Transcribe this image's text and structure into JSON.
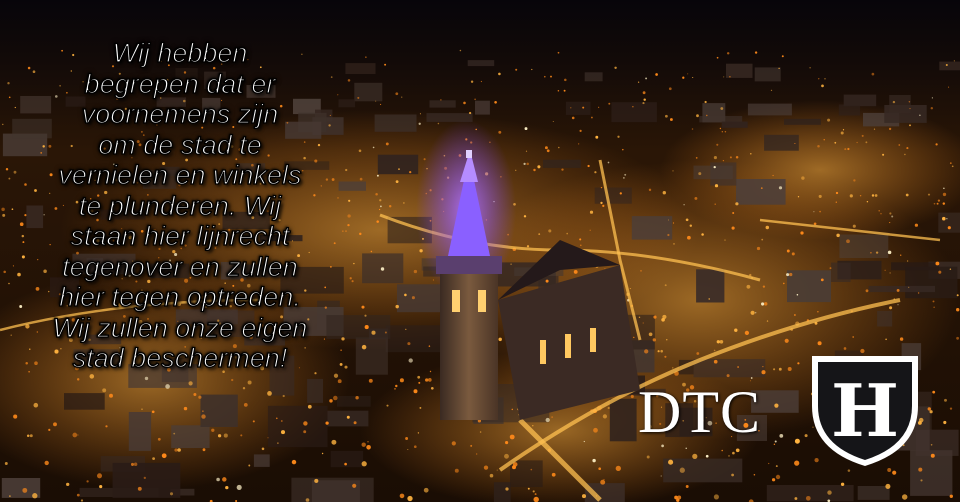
{
  "message": {
    "lines": [
      "Wij hebben",
      "begrepen dat er",
      "voornemens zijn",
      "om de stad te",
      "vernielen en winkels",
      "te plunderen. Wij",
      "staan hier lijnrecht",
      "tegenover en zullen",
      "hier tegen optreden.",
      "Wij zullen onze eigen",
      "stad beschermen!"
    ]
  },
  "logo": {
    "wordmark": "DTC",
    "emblem_letter": "H",
    "icon": "shield-emblem-icon"
  },
  "colors": {
    "sky": "#0b0710",
    "city_glow": "#f0a030",
    "tower_light": "#7a4cff",
    "text": "#ffffff"
  }
}
